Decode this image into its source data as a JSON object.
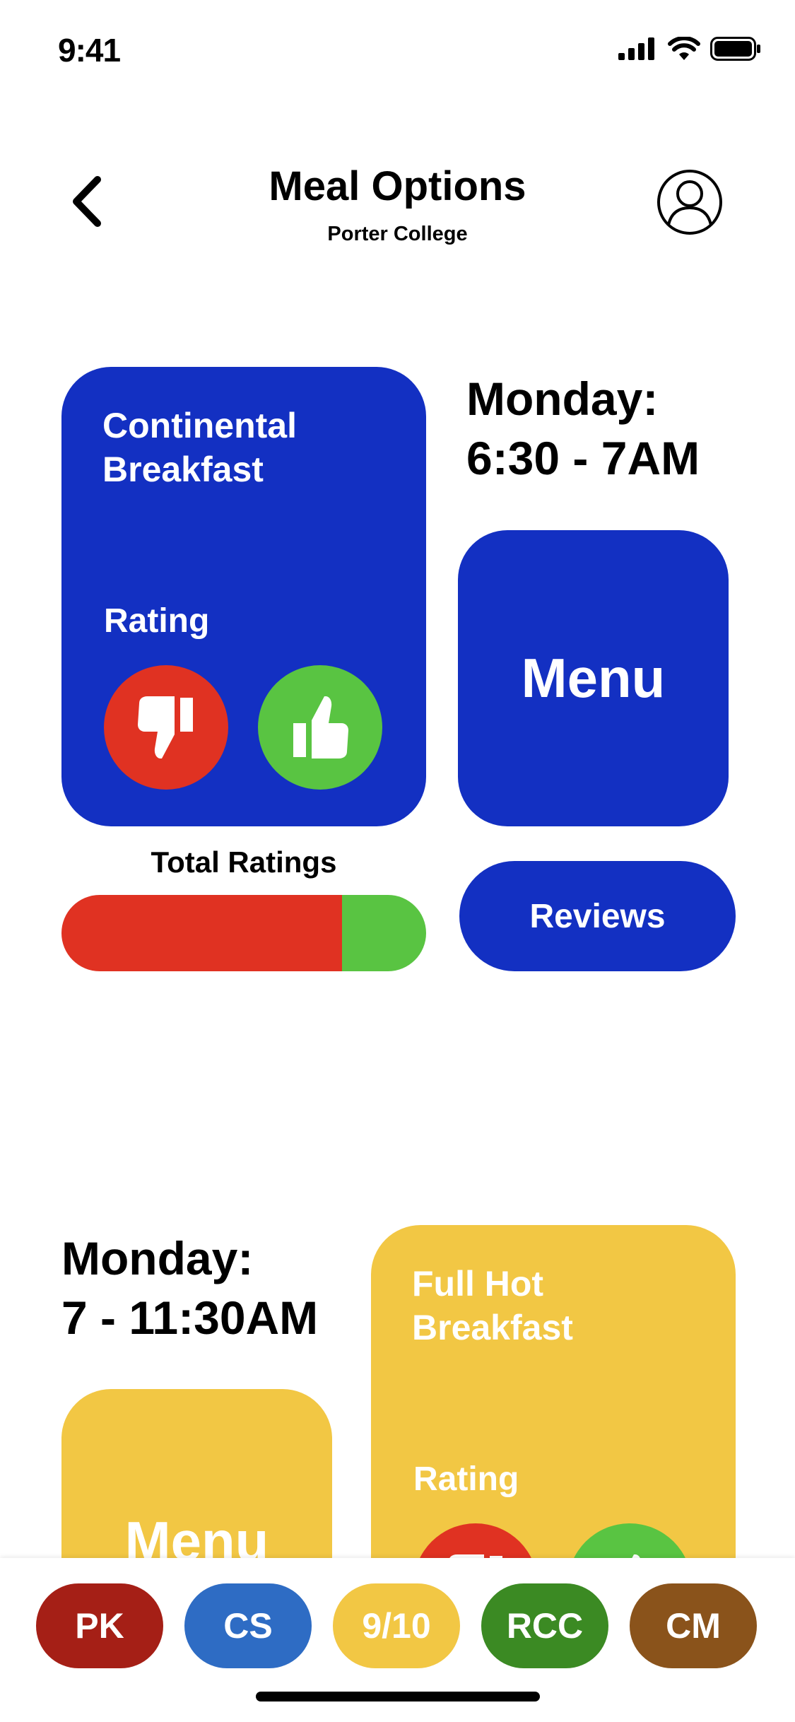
{
  "status_bar": {
    "time": "9:41"
  },
  "header": {
    "title": "Meal Options",
    "subtitle": "Porter College"
  },
  "meals": [
    {
      "name": "Continental Breakfast",
      "day": "Monday:",
      "hours": "6:30 - 7AM",
      "rating_label": "Rating",
      "menu_label": "Menu",
      "reviews_label": "Reviews",
      "total_ratings_label": "Total Ratings",
      "dislike_fraction": 0.77,
      "colors": {
        "card": "#1330c2"
      }
    },
    {
      "name": "Full Hot Breakfast",
      "day": "Monday:",
      "hours": "7 - 11:30AM",
      "rating_label": "Rating",
      "menu_label": "Menu",
      "colors": {
        "card": "#f2c744"
      }
    }
  ],
  "bottom_nav": [
    {
      "label": "PK",
      "color": "#a51f16"
    },
    {
      "label": "CS",
      "color": "#2e6cc4"
    },
    {
      "label": "9/10",
      "color": "#f2c744"
    },
    {
      "label": "RCC",
      "color": "#3b8a23"
    },
    {
      "label": "CM",
      "color": "#8a531b"
    }
  ],
  "icons": [
    "back-chevron-icon",
    "profile-icon",
    "thumbs-down-icon",
    "thumbs-up-icon",
    "signal-icon",
    "wifi-icon",
    "battery-icon"
  ]
}
